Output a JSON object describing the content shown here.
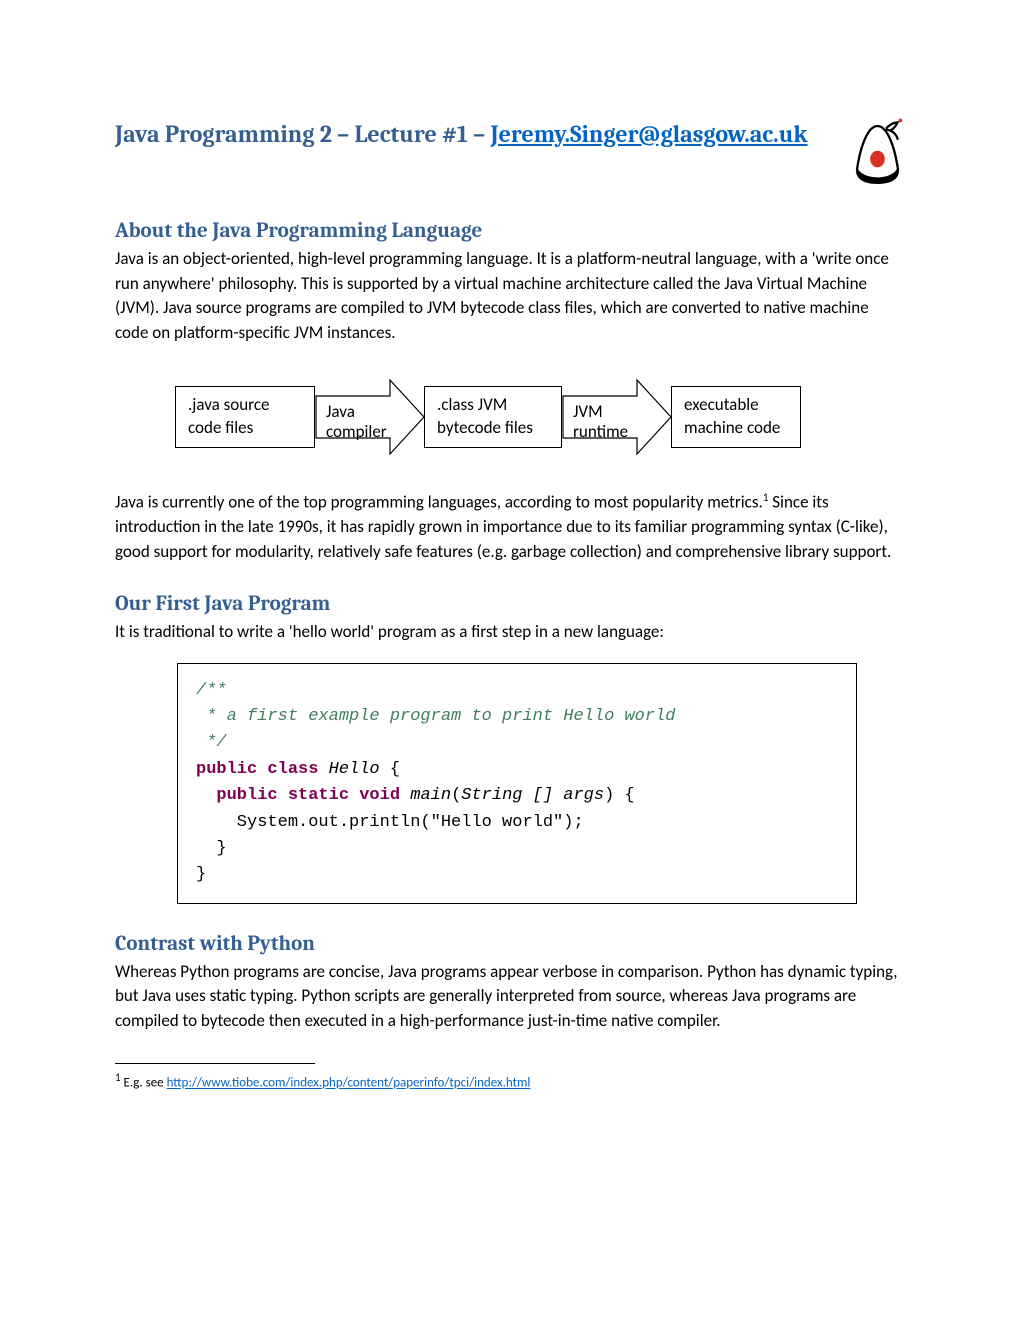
{
  "title": {
    "prefix": "Java Programming 2 – Lecture #1 – ",
    "email": "Jeremy.Singer@glasgow.ac.uk"
  },
  "sections": {
    "about": {
      "heading": "About the Java Programming Language",
      "para": "Java is an object-oriented, high-level programming language. It is a platform-neutral language, with a 'write once run anywhere' philosophy. This is supported by a virtual machine architecture called the Java Virtual Machine (JVM). Java source programs are compiled to JVM bytecode class files, which are converted to native machine code on platform-specific JVM instances."
    },
    "diagram": {
      "box1": ".java source code files",
      "arrow1": "Java compiler",
      "box2": ".class JVM bytecode files",
      "arrow2": "JVM runtime",
      "box3": "executable machine code"
    },
    "about2": {
      "text_before_ref": "Java is currently one of the top programming languages, according to most popularity metrics.",
      "ref": "1",
      "text_after_ref": " Since its introduction in the late 1990s, it has rapidly grown in importance due to its familiar programming syntax (C-like), good support for modularity, relatively safe features (e.g. garbage collection) and comprehensive library support."
    },
    "first": {
      "heading": "Our First Java Program",
      "para": "It is traditional to write a 'hello world' program as a first step in a new language:"
    },
    "code": {
      "l1": "/**",
      "l2": " * a first example program to print Hello world",
      "l3": " */",
      "kw_pc": "public class",
      "cls": " Hello",
      "brace_open": " {",
      "kw_psv": "public static void",
      "main_sig": " main",
      "params": "(String [] args",
      "params_close": ") {",
      "println": "    System.out.println(\"Hello world\");",
      "close1": "  }",
      "close2": "}"
    },
    "contrast": {
      "heading": "Contrast with Python",
      "para": "Whereas Python programs are concise, Java programs appear verbose in comparison. Python has dynamic typing, but Java uses static typing. Python scripts are generally interpreted from source, whereas Java programs are compiled to bytecode then executed in a high-performance just-in-time native compiler."
    }
  },
  "footnote": {
    "num": "1",
    "prefix": " E.g. see ",
    "url": "http://www.tiobe.com/index.php/content/paperinfo/tpci/index.html"
  }
}
